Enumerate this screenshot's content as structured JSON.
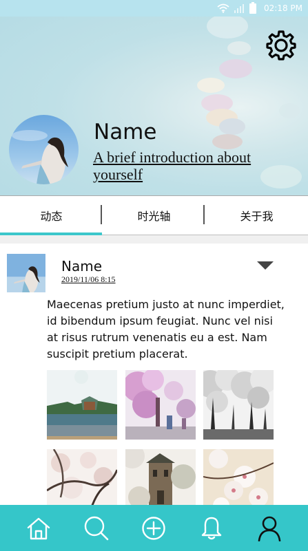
{
  "status_bar": {
    "time": "02:18 PM",
    "icons": [
      "wifi-icon",
      "signal-icon",
      "battery-icon"
    ]
  },
  "profile": {
    "name": "Name",
    "intro": "A brief introduction about yourself"
  },
  "tabs": [
    {
      "label": "动态",
      "active": true
    },
    {
      "label": "时光轴",
      "active": false
    },
    {
      "label": "关于我",
      "active": false
    }
  ],
  "post": {
    "name": "Name",
    "date": "2019/11/06  8:15",
    "text": "Maecenas pretium justo at nunc imperdiet, id bibendum ipsum feugiat. Nunc vel nisi at risus rutrum venenatis eu a est. Nam suscipit pretium placerat.",
    "photos": [
      "campus-lake-photo",
      "pink-blossom-street-photo",
      "bw-cherry-trees-photo",
      "blossom-branches-photo",
      "old-building-photo",
      "cherry-blossom-closeup-photo"
    ]
  },
  "bottom_nav": [
    {
      "icon": "home-icon"
    },
    {
      "icon": "search-icon"
    },
    {
      "icon": "add-icon"
    },
    {
      "icon": "bell-icon"
    },
    {
      "icon": "user-icon"
    }
  ],
  "colors": {
    "accent": "#35c6c9",
    "tab_indicator": "#3cc7cb",
    "header_bg": "#bfe0e7",
    "status_bar": "#b7e3ee"
  }
}
